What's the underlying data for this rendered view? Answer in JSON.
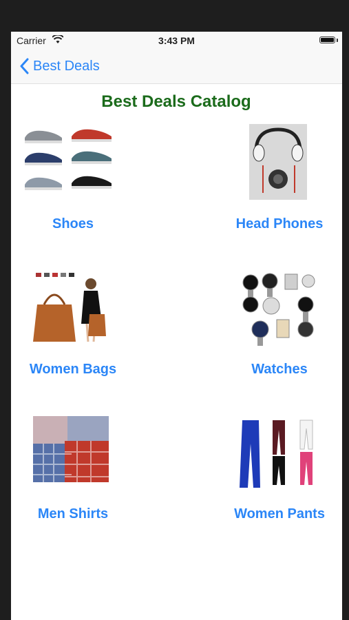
{
  "status_bar": {
    "carrier": "Carrier",
    "time": "3:43 PM"
  },
  "nav": {
    "back_label": "Best Deals"
  },
  "title": "Best Deals Catalog",
  "colors": {
    "accent": "#2b86f7",
    "title": "#1b6b1b"
  },
  "categories": [
    {
      "label": "Shoes"
    },
    {
      "label": "Head Phones"
    },
    {
      "label": "Women Bags"
    },
    {
      "label": "Watches"
    },
    {
      "label": "Men Shirts"
    },
    {
      "label": "Women Pants"
    }
  ]
}
